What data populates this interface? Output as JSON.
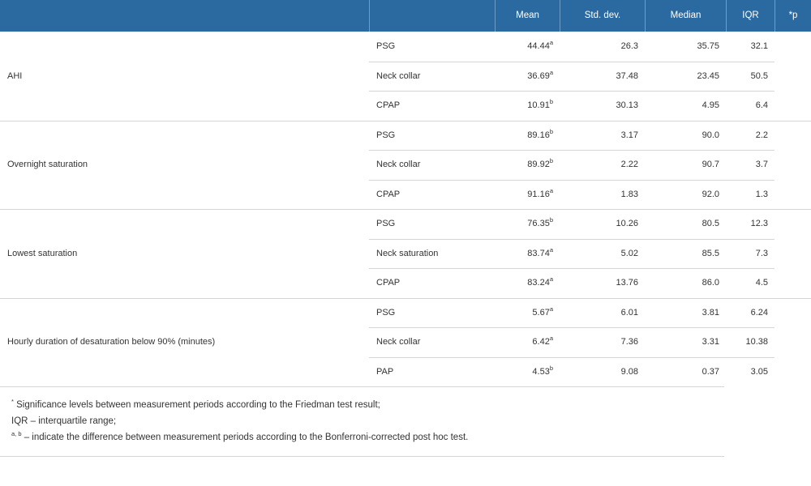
{
  "table": {
    "headers": {
      "group": "",
      "period": "",
      "mean": "Mean",
      "std_dev": "Std. dev.",
      "median": "Median",
      "iqr": "IQR",
      "p": "*p"
    },
    "groups": [
      {
        "label": "AHI",
        "rows": [
          {
            "period": "PSG",
            "mean": "44.44",
            "mean_sup": "a",
            "std": "26.3",
            "median": "35.75",
            "iqr": "32.1"
          },
          {
            "period": "Neck collar",
            "mean": "36.69",
            "mean_sup": "a",
            "std": "37.48",
            "median": "23.45",
            "iqr": "50.5"
          },
          {
            "period": "CPAP",
            "mean": "10.91",
            "mean_sup": "b",
            "std": "30.13",
            "median": "4.95",
            "iqr": "6.4"
          }
        ]
      },
      {
        "label": "Overnight saturation",
        "rows": [
          {
            "period": "PSG",
            "mean": "89.16",
            "mean_sup": "b",
            "std": "3.17",
            "median": "90.0",
            "iqr": "2.2"
          },
          {
            "period": "Neck collar",
            "mean": "89.92",
            "mean_sup": "b",
            "std": "2.22",
            "median": "90.7",
            "iqr": "3.7"
          },
          {
            "period": "CPAP",
            "mean": "91.16",
            "mean_sup": "a",
            "std": "1.83",
            "median": "92.0",
            "iqr": "1.3"
          }
        ]
      },
      {
        "label": "Lowest saturation",
        "rows": [
          {
            "period": "PSG",
            "mean": "76.35",
            "mean_sup": "b",
            "std": "10.26",
            "median": "80.5",
            "iqr": "12.3"
          },
          {
            "period": "Neck saturation",
            "mean": "83.74",
            "mean_sup": "a",
            "std": "5.02",
            "median": "85.5",
            "iqr": "7.3"
          },
          {
            "period": "CPAP",
            "mean": "83.24",
            "mean_sup": "a",
            "std": "13.76",
            "median": "86.0",
            "iqr": "4.5"
          }
        ]
      },
      {
        "label": "Hourly duration of desaturation below 90% (minutes)",
        "rows": [
          {
            "period": "PSG",
            "mean": "5.67",
            "mean_sup": "a",
            "std": "6.01",
            "median": "3.81",
            "iqr": "6.24"
          },
          {
            "period": "Neck collar",
            "mean": "6.42",
            "mean_sup": "a",
            "std": "7.36",
            "median": "3.31",
            "iqr": "10.38"
          },
          {
            "period": "PAP",
            "mean": "4.53",
            "mean_sup": "b",
            "std": "9.08",
            "median": "0.37",
            "iqr": "3.05"
          }
        ]
      }
    ]
  },
  "footnotes": [
    {
      "sup": "*",
      "text": " Significance levels between measurement periods according to the Friedman test result;"
    },
    {
      "sup": "",
      "text": "IQR – interquartile range;"
    },
    {
      "sup": "a, b",
      "text": " – indicate the difference between measurement periods according to the Bonferroni-corrected post hoc test."
    }
  ],
  "colors": {
    "header_bg": "#2a6aa0",
    "header_text": "#ffffff",
    "grid_line": "#d5d5d5",
    "body_text": "#333333"
  }
}
